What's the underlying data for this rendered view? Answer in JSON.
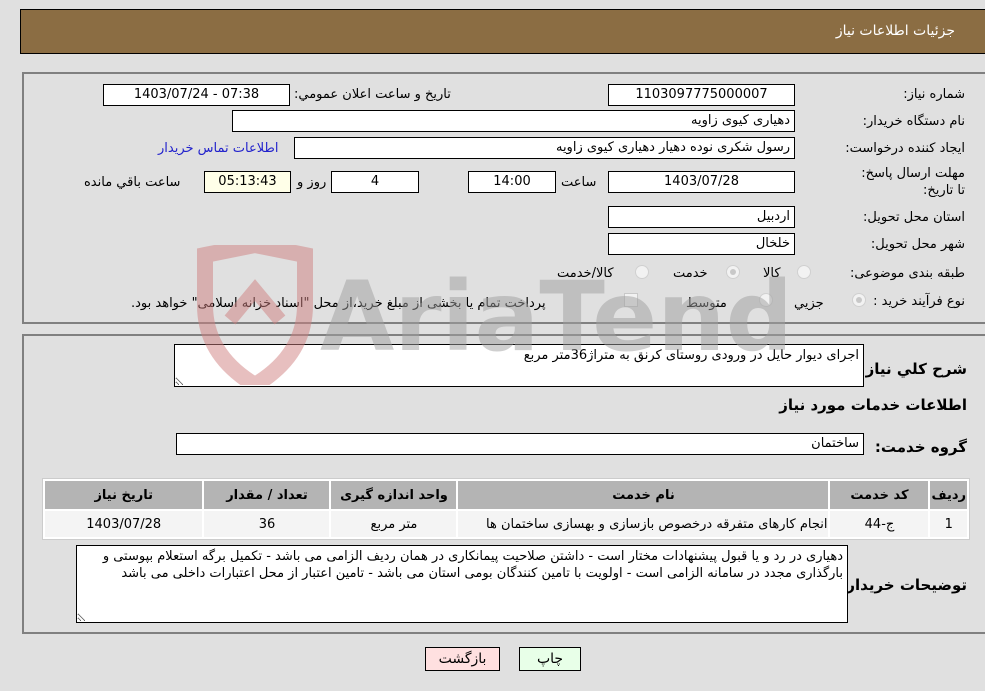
{
  "header": {
    "title": "جزئیات اطلاعات نیاز"
  },
  "colors": {
    "header_bg": "#8b6d43",
    "remaining_bg": "#ffffe8",
    "back_btn_bg": "#ffe0e0",
    "print_btn_bg": "#e8ffe8",
    "link": "#2222cc"
  },
  "form": {
    "need_number": {
      "label": "شماره نیاز:",
      "value": "1103097775000007"
    },
    "announce_datetime": {
      "label": "تاریخ و ساعت اعلان عمومي:",
      "value": "1403/07/24 - 07:38"
    },
    "buyer_org": {
      "label": "نام دستگاه خريدار:",
      "value": "دهیاری کیوی زاویه"
    },
    "requester": {
      "label": "ايجاد کننده درخواست:",
      "value": "رسول شکری نوده دهیار دهیاری کیوی زاویه"
    },
    "buyer_contact_link": "اطلاعات تماس خريدار",
    "deadline": {
      "label": "مهلت ارسال پاسخ: تا تاريخ:",
      "date": "1403/07/28",
      "time_label": "ساعت",
      "time": "14:00",
      "days": "4",
      "days_label": "روز و",
      "remaining": "05:13:43",
      "remaining_label": "ساعت باقي مانده"
    },
    "province": {
      "label": "استان محل تحويل:",
      "value": "اردبیل"
    },
    "city": {
      "label": "شهر محل تحويل:",
      "value": "خلخال"
    },
    "category": {
      "label": "طبقه بندی موضوعی:",
      "options": [
        "کالا",
        "خدمت",
        "کالا/خدمت"
      ],
      "selected": "خدمت"
    },
    "purchase_type": {
      "label": "نوع فرآيند خريد :",
      "options": [
        "جزيي",
        "متوسط"
      ],
      "selected": "جزيي",
      "treasury_note": "پرداخت تمام يا بخشی از مبلغ خريد،از محل \"اسناد خزانه اسلامی\" خواهد بود."
    }
  },
  "details": {
    "description_label": "شرح کلي نياز:",
    "description": "اجرای دیوار حایل در ورودی روستای کرنق به متراژ36متر مربع",
    "services_heading": "اطلاعات خدمات مورد نياز",
    "service_group_label": "گروه خدمت:",
    "service_group": "ساختمان",
    "table": {
      "headers": [
        "رديف",
        "کد خدمت",
        "نام خدمت",
        "واحد اندازه گيری",
        "تعداد / مقدار",
        "تاريخ نياز"
      ],
      "rows": [
        [
          "1",
          "ج-44",
          "انجام کارهای متفرقه درخصوص بازسازی و بهسازی ساختمان ها",
          "متر مربع",
          "36",
          "1403/07/28"
        ]
      ]
    },
    "buyer_notes_label": "توضيحات خريدار:",
    "buyer_notes": "دهیاری در رد و یا قبول پیشنهادات مختار است - داشتن صلاحیت پیمانکاری در همان ردیف الزامی می باشد - تکمیل برگه استعلام بپوستی و بارگذاری مجدد در سامانه الزامی است - اولویت با تامین کنندگان بومی استان می باشد - تامین اعتبار از محل اعتبارات داخلی می باشد"
  },
  "buttons": {
    "print": "چاپ",
    "back": "بازگشت"
  },
  "watermark": "AriaTender.neT"
}
